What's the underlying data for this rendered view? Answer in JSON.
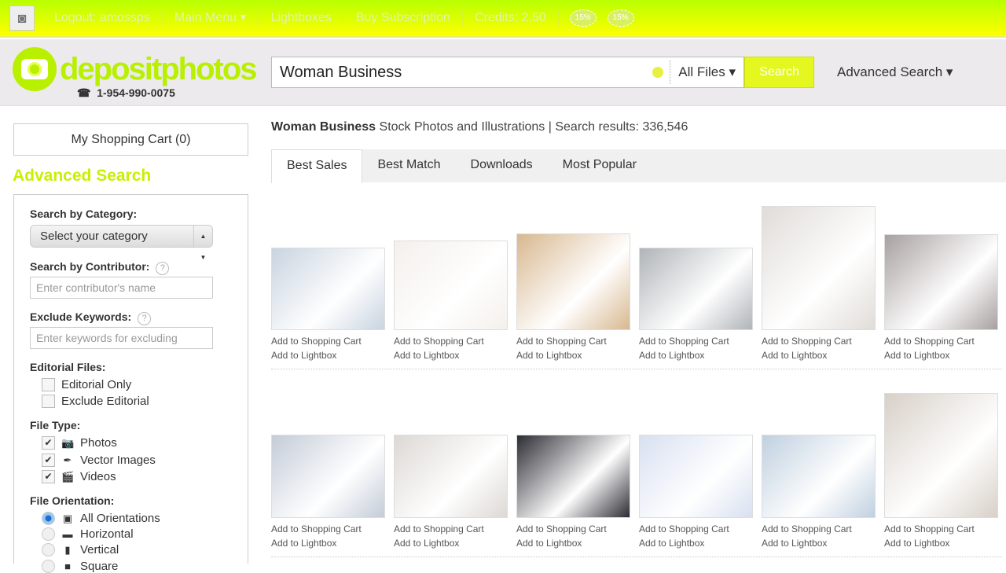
{
  "topbar": {
    "items": [
      "Logout: amossps",
      "Main Menu ▾",
      "Lightboxes",
      "Buy Subscription",
      "Credits: 2.50"
    ],
    "badges": [
      "15%",
      "15%"
    ]
  },
  "header": {
    "logo": "depositphotos",
    "phone": "1-954-990-0075",
    "search_value": "Woman Business",
    "file_type": "All Files ▾",
    "search_button": "Search",
    "advanced": "Advanced Search ▾"
  },
  "sidebar": {
    "cart": "My Shopping Cart (0)",
    "advanced_title": "Advanced Search",
    "category_label": "Search by Category:",
    "category_select": "Select your category",
    "contributor_label": "Search by Contributor:",
    "contributor_placeholder": "Enter contributor's name",
    "exclude_label": "Exclude Keywords:",
    "exclude_placeholder": "Enter keywords for excluding",
    "editorial_label": "Editorial Files:",
    "editorial_only": "Editorial Only",
    "exclude_editorial": "Exclude Editorial",
    "filetype_label": "File Type:",
    "photos": "Photos",
    "vectors": "Vector Images",
    "videos": "Videos",
    "orientation_label": "File Orientation:",
    "all_orient": "All Orientations",
    "horizontal": "Horizontal",
    "vertical": "Vertical",
    "square": "Square",
    "help": "?"
  },
  "results": {
    "query": "Woman Business",
    "suffix": " Stock Photos and Illustrations | Search results: 336,546",
    "tabs": [
      "Best Sales",
      "Best Match",
      "Downloads",
      "Most Popular"
    ],
    "add_cart": "Add to Shopping Cart",
    "add_lightbox": "Add to Lightbox"
  }
}
